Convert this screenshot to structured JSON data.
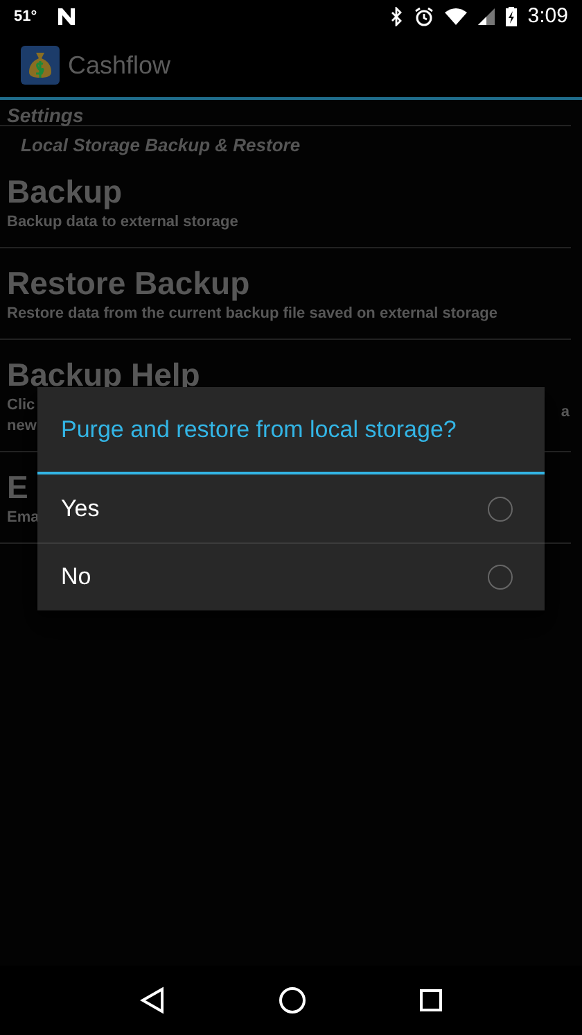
{
  "status_bar": {
    "temperature": "51°",
    "time": "3:09"
  },
  "app_bar": {
    "title": "Cashflow"
  },
  "header": "Settings",
  "subheader": "Local Storage Backup & Restore",
  "preferences": [
    {
      "title": "Backup",
      "summary_lines": [
        "Backup data to external storage"
      ]
    },
    {
      "title": "Restore Backup",
      "summary_lines": [
        "Restore data from the current backup file saved on external storage"
      ]
    },
    {
      "title": "Backup Help",
      "summary_lines": [
        "Clic",
        "new"
      ],
      "summary_right": "a"
    },
    {
      "title": "E",
      "summary_lines": [
        "Ema"
      ]
    }
  ],
  "dialog": {
    "title": "Purge and restore from local storage?",
    "options": [
      {
        "label": "Yes",
        "selected": false
      },
      {
        "label": "No",
        "selected": false
      }
    ]
  }
}
